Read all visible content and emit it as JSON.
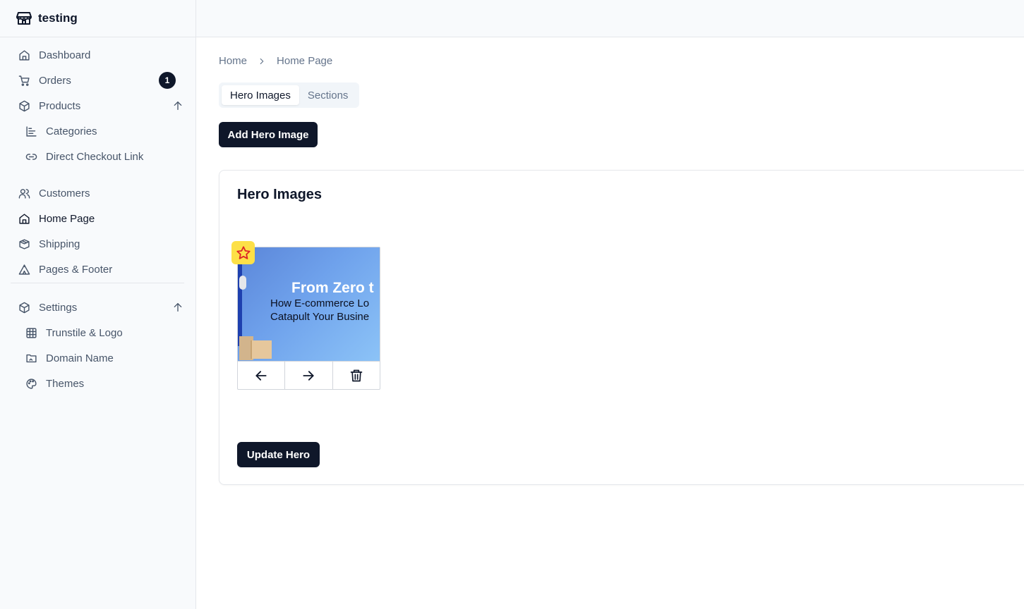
{
  "brand": {
    "name": "testing",
    "icon": "store-icon"
  },
  "sidebar": {
    "items": [
      {
        "label": "Dashboard",
        "icon": "home-icon"
      },
      {
        "label": "Orders",
        "icon": "cart-icon",
        "badge": "1"
      },
      {
        "label": "Products",
        "icon": "package-icon",
        "expanded": true
      },
      {
        "label": "Categories",
        "icon": "chart-icon"
      },
      {
        "label": "Direct Checkout Link",
        "icon": "link-icon"
      },
      {
        "label": "Customers",
        "icon": "users-icon"
      },
      {
        "label": "Home Page",
        "icon": "home-icon",
        "active": true
      },
      {
        "label": "Shipping",
        "icon": "box-icon"
      },
      {
        "label": "Pages & Footer",
        "icon": "tent-icon"
      },
      {
        "label": "Settings",
        "icon": "package-icon",
        "expanded": true
      },
      {
        "label": "Trunstile & Logo",
        "icon": "grid-icon"
      },
      {
        "label": "Domain Name",
        "icon": "folder-icon"
      },
      {
        "label": "Themes",
        "icon": "palette-icon"
      }
    ]
  },
  "breadcrumb": {
    "home": "Home",
    "current": "Home Page"
  },
  "tabs": [
    {
      "label": "Hero Images",
      "active": true
    },
    {
      "label": "Sections",
      "active": false
    }
  ],
  "actions": {
    "add_label": "Add Hero Image",
    "update_label": "Update Hero"
  },
  "card": {
    "title": "Hero Images",
    "hero": {
      "headline": "From Zero t",
      "line1": "How E-commerce Lo",
      "line2": "Catapult Your Busine",
      "featured": true
    }
  },
  "colors": {
    "primary": "#0f172a",
    "star": "#fde047",
    "star_stroke": "#dc2626"
  }
}
